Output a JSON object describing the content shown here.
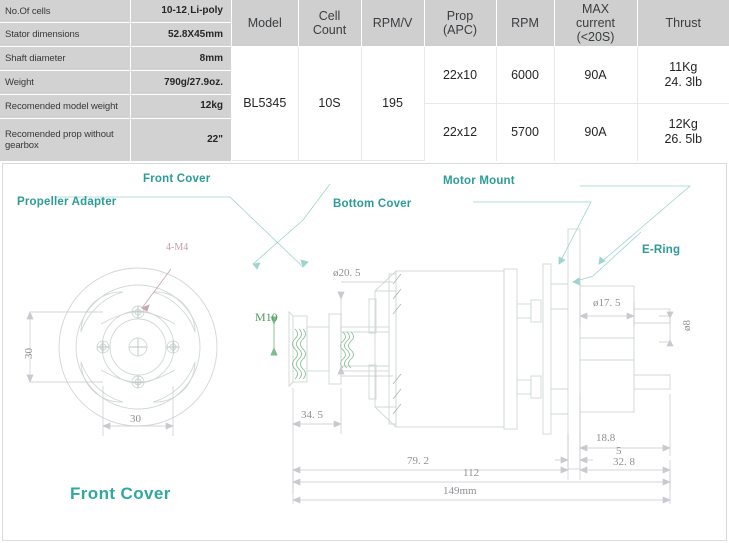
{
  "spec_table": {
    "rows": [
      {
        "label": "No.Of cells",
        "value": "10-12ˌLi-poly"
      },
      {
        "label": "Stator dimensions",
        "value": "52.8X45mm"
      },
      {
        "label": "Shaft diameter",
        "value": "8mm"
      },
      {
        "label": "Weight",
        "value": "790g/27.9oz."
      },
      {
        "label": "Recomended model weight",
        "value": "12kg"
      },
      {
        "label": "Recomended prop without gearbox",
        "value": "22\""
      }
    ]
  },
  "perf_table": {
    "headers": [
      "Model",
      "Cell Count",
      "RPM/V",
      "Prop (APC)",
      "RPM",
      "MAX current (<20S)",
      "Thrust"
    ],
    "headers_multiline": [
      [
        "Model"
      ],
      [
        "Cell",
        "Count"
      ],
      [
        "RPM/V"
      ],
      [
        "Prop",
        "(APC)"
      ],
      [
        "RPM"
      ],
      [
        "MAX",
        "current",
        "(<20S)"
      ],
      [
        "Thrust"
      ]
    ],
    "model": "BL5345",
    "cell_count": "10S",
    "rpm_per_volt": "195",
    "rows": [
      {
        "prop": "22x10",
        "rpm": "6000",
        "max_current": "90A",
        "thrust_kg": "11Kg",
        "thrust_lb": "24. 3lb"
      },
      {
        "prop": "22x12",
        "rpm": "5700",
        "max_current": "90A",
        "thrust_kg": "12Kg",
        "thrust_lb": "26. 5lb"
      }
    ]
  },
  "drawing": {
    "callouts": [
      {
        "name": "propeller-adapter",
        "text": "Propeller Adapter"
      },
      {
        "name": "front-cover",
        "text": "Front Cover"
      },
      {
        "name": "bottom-cover",
        "text": "Bottom Cover"
      },
      {
        "name": "motor-mount",
        "text": "Motor Mount"
      },
      {
        "name": "e-ring",
        "text": "E-Ring"
      }
    ],
    "front_cover_title": "Front Cover",
    "annotations": {
      "bolt_spec": "4-M4",
      "thread_spec": "M10",
      "dia_20_5": "ø20. 5",
      "dia_17_5": "ø17. 5",
      "dia_8": "ø8"
    },
    "dimensions": {
      "front_cover_vertical": "30",
      "front_cover_horizontal": "30",
      "adapter_length": "34. 5",
      "mount_to_tip": "18.8",
      "mount_thickness": "5",
      "rear_section": "32. 8",
      "body_length": "79. 2",
      "overall_no_shaft": "112",
      "overall_length": "149mm"
    },
    "colors": {
      "teal": "#2b9c97",
      "dim_gray": "#8f8f95",
      "green": "#4e9d62",
      "pink": "#c99aa8",
      "outline": "#cfd8d4"
    }
  }
}
